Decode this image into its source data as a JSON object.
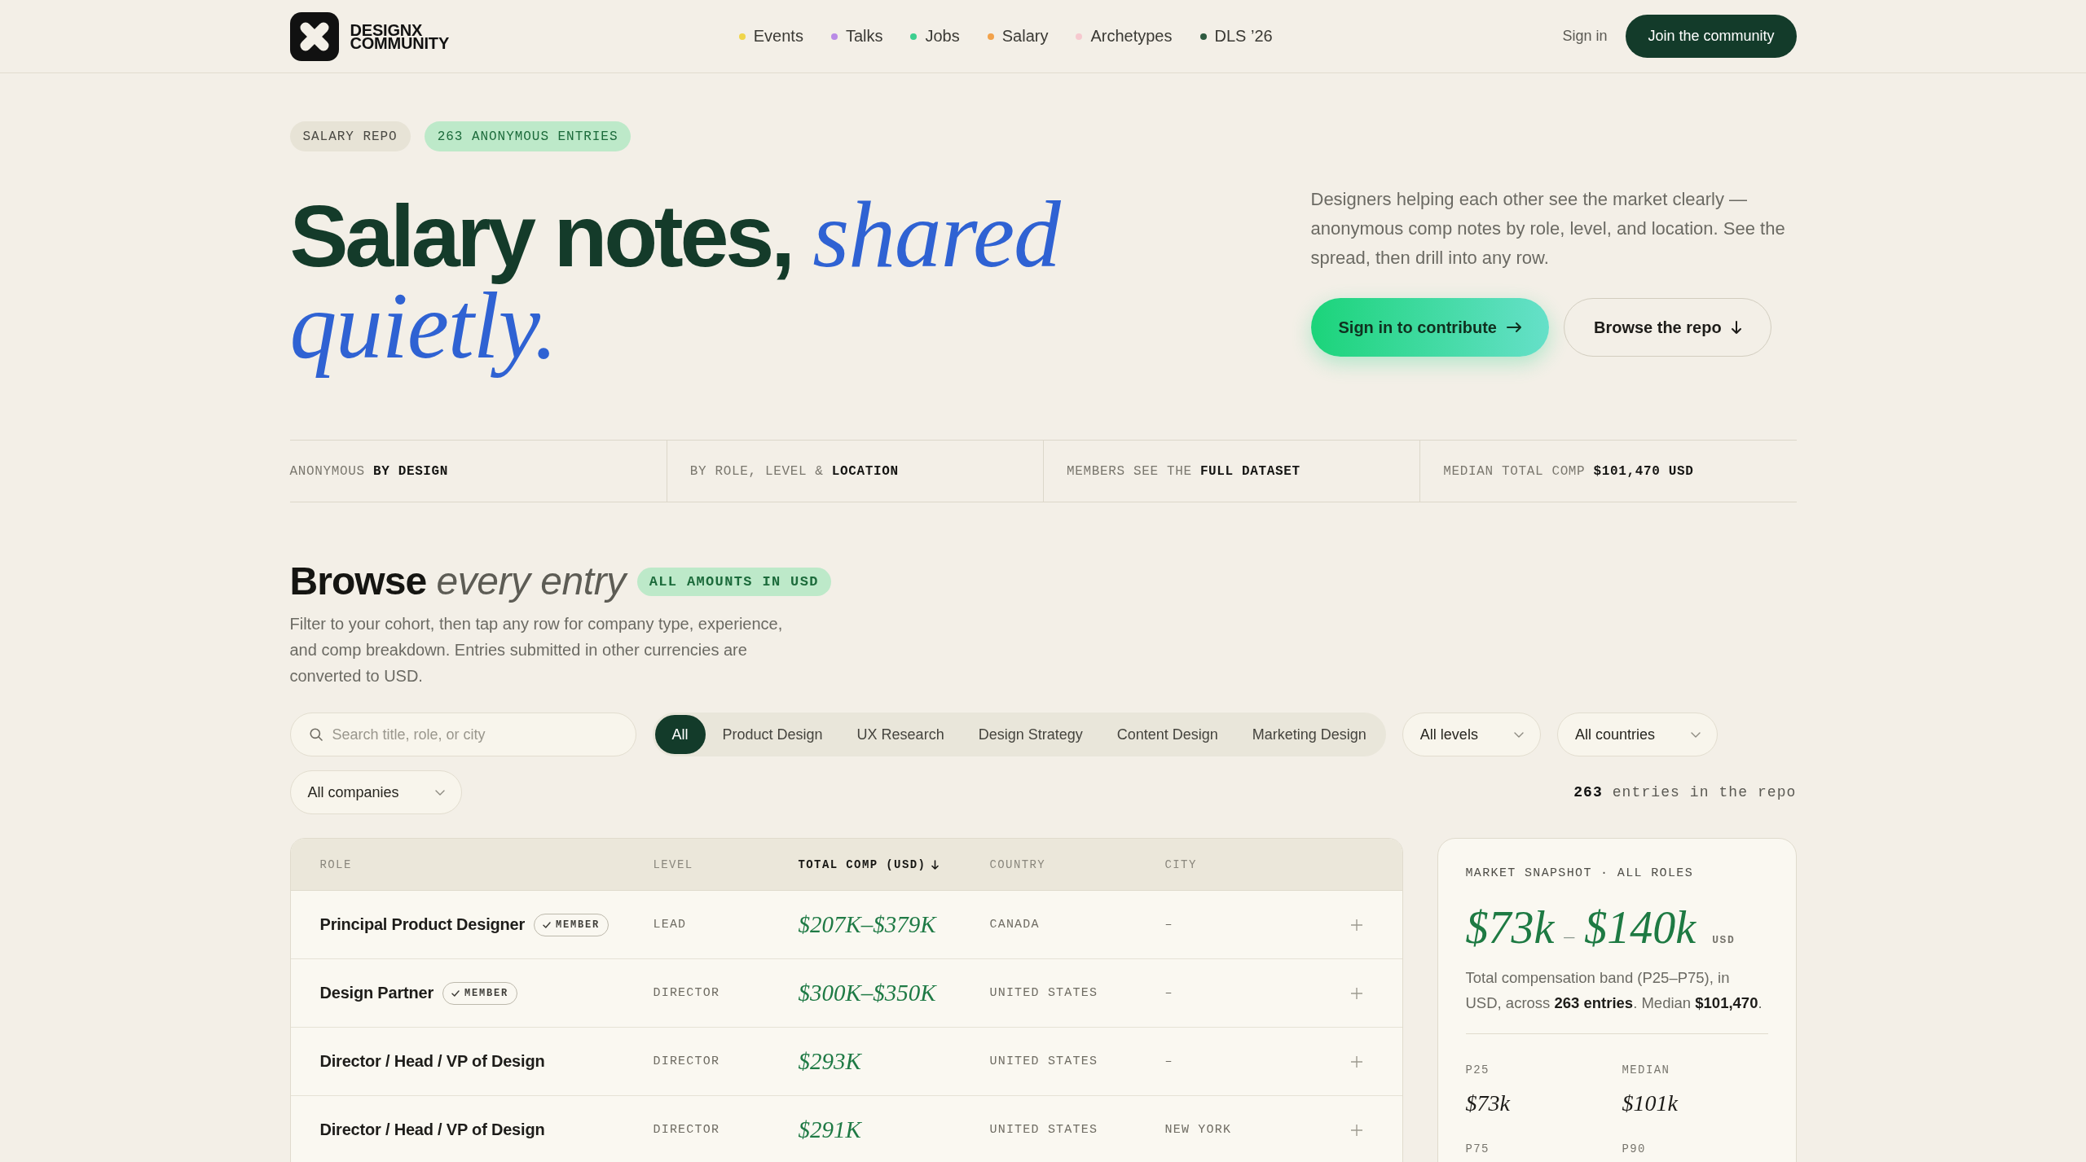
{
  "header": {
    "logo": {
      "lines": [
        "DESIGNX",
        "COMMUNITY"
      ]
    },
    "nav": [
      {
        "label": "Events",
        "color": "#f0d54a"
      },
      {
        "label": "Talks",
        "color": "#b98be6"
      },
      {
        "label": "Jobs",
        "color": "#3ccf8f"
      },
      {
        "label": "Salary",
        "color": "#f2a24b"
      },
      {
        "label": "Archetypes",
        "color": "#f6c9cf"
      },
      {
        "label": "DLS ’26",
        "color": "#2e5a40"
      }
    ],
    "sign_in": "Sign in",
    "cta": "Join the community"
  },
  "hero": {
    "badges": [
      {
        "label": "SALARY REPO",
        "kind": "neutral"
      },
      {
        "label": "263 ANONYMOUS ENTRIES",
        "kind": "accent"
      }
    ],
    "title": "Salary notes, *shared quietly.*",
    "description": "Designers helping each other see the market clearly — anonymous comp notes by role, level, and location. See the spread, then drill into any row.",
    "primary_button": "Sign in to contribute",
    "secondary_button": "Browse the repo"
  },
  "highlights": [
    "ANONYMOUS **BY DESIGN**",
    "BY ROLE, LEVEL & **LOCATION**",
    "MEMBERS SEE THE **FULL DATASET**",
    "MEDIAN TOTAL COMP **$101,470 USD**"
  ],
  "browse": {
    "title": "Browse *every entry*",
    "badge": "ALL AMOUNTS IN USD",
    "description": "Filter to your cohort, then tap any row for company type, experience, and comp breakdown. Entries submitted in other currencies are converted to USD."
  },
  "filters": {
    "search": {
      "placeholder": "Search title, role, or city"
    },
    "tabs": [
      {
        "label": "All",
        "selected": true
      },
      {
        "label": "Product Design",
        "selected": false
      },
      {
        "label": "UX Research",
        "selected": false
      },
      {
        "label": "Design Strategy",
        "selected": false
      },
      {
        "label": "Content Design",
        "selected": false
      },
      {
        "label": "Marketing Design",
        "selected": false
      }
    ],
    "dropdowns": [
      {
        "value": "All levels"
      },
      {
        "value": "All countries"
      },
      {
        "value": "All companies"
      }
    ],
    "count": "**263** entries in the repo"
  },
  "table": {
    "columns": [
      {
        "label": "ROLE",
        "sorted": false
      },
      {
        "label": "LEVEL",
        "sorted": false
      },
      {
        "label": "TOTAL COMP (USD)",
        "sorted": true
      },
      {
        "label": "COUNTRY",
        "sorted": false
      },
      {
        "label": "CITY",
        "sorted": false
      }
    ],
    "rows": [
      {
        "role": "Principal Product Designer",
        "badge": "MEMBER",
        "level": "LEAD",
        "total_comp": "$207K–$379K",
        "country": "CANADA",
        "city": "–"
      },
      {
        "role": "Design Partner",
        "badge": "MEMBER",
        "level": "DIRECTOR",
        "total_comp": "$300K–$350K",
        "country": "UNITED STATES",
        "city": "–"
      },
      {
        "role": "Director / Head / VP of Design",
        "level": "DIRECTOR",
        "total_comp": "$293K",
        "country": "UNITED STATES",
        "city": "–"
      },
      {
        "role": "Director / Head / VP of Design",
        "level": "DIRECTOR",
        "total_comp": "$291K",
        "country": "UNITED STATES",
        "city": "NEW YORK"
      }
    ]
  },
  "snapshot": {
    "label": "MARKET SNAPSHOT · ALL ROLES",
    "band": {
      "low": "$73k",
      "separator": "–",
      "high": "$140k",
      "currency": "USD"
    },
    "note": "Total compensation band (P25–P75), in USD, across **263 entries**. Median **$101,470**.",
    "stats": [
      {
        "label": "P25",
        "value": "$73k"
      },
      {
        "label": "MEDIAN",
        "value": "$101k"
      },
      {
        "label": "P75"
      },
      {
        "label": "P90"
      }
    ]
  }
}
